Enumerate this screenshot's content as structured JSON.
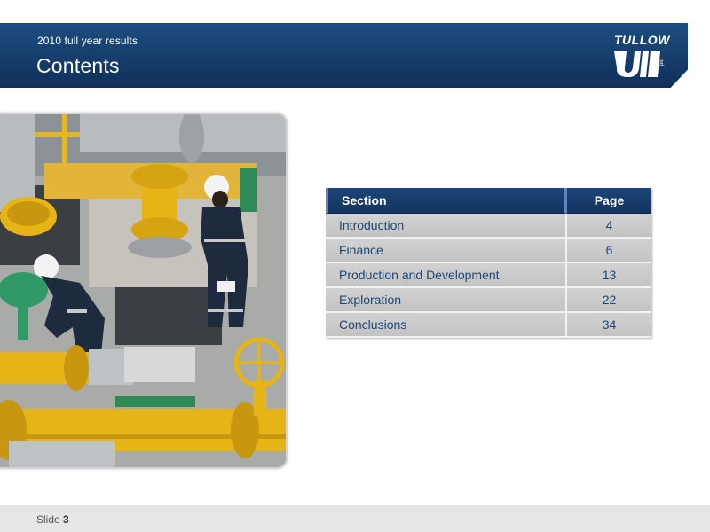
{
  "header": {
    "subtitle": "2010 full year results",
    "title": "Contents"
  },
  "logo": {
    "text": "TULLOW",
    "suffix": "plc"
  },
  "photo": {
    "description_icon": "oil-facility-workers-photo"
  },
  "table": {
    "headers": {
      "section": "Section",
      "page": "Page"
    },
    "rows": [
      {
        "section": "Introduction",
        "page": "4"
      },
      {
        "section": "Finance",
        "page": "6"
      },
      {
        "section": "Production and Development",
        "page": "13"
      },
      {
        "section": "Exploration",
        "page": "22"
      },
      {
        "section": "Conclusions",
        "page": "34"
      }
    ]
  },
  "footer": {
    "slide_label": "Slide",
    "slide_number": "3"
  },
  "colors": {
    "header_blue": "#163d6b",
    "table_text": "#1f4775",
    "row_gray": "#c8c8c8",
    "pipe_yellow": "#e8b50f"
  }
}
